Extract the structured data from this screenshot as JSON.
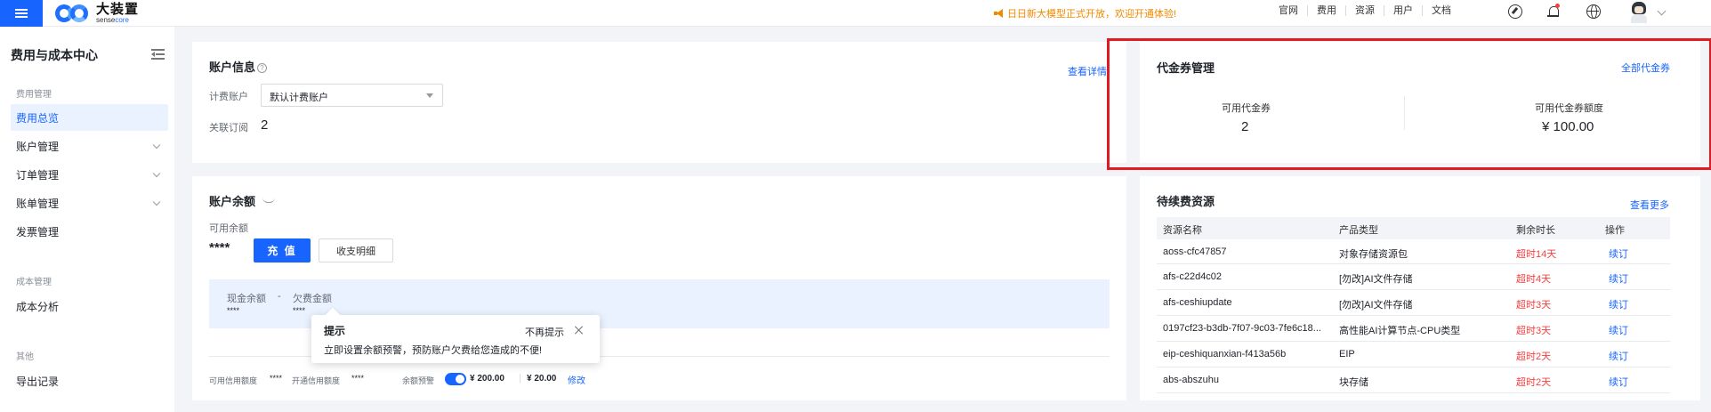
{
  "header": {
    "logo_text": "大装置",
    "logo_sub_a": "sense",
    "logo_sub_b": "core",
    "announcement": "日日新大模型正式开放，欢迎开通体验!",
    "nav": [
      "官网",
      "费用",
      "资源",
      "用户",
      "文档"
    ],
    "icons": [
      "compass-icon",
      "bell-icon",
      "globe-icon",
      "avatar"
    ]
  },
  "sidebar": {
    "title": "费用与成本中心",
    "groups": [
      {
        "label": "费用管理",
        "items": [
          {
            "label": "费用总览",
            "active": true
          },
          {
            "label": "账户管理",
            "expandable": true
          },
          {
            "label": "订单管理",
            "expandable": true
          },
          {
            "label": "账单管理",
            "expandable": true
          },
          {
            "label": "发票管理"
          }
        ]
      },
      {
        "label": "成本管理",
        "items": [
          {
            "label": "成本分析"
          }
        ]
      },
      {
        "label": "其他",
        "items": [
          {
            "label": "导出记录"
          }
        ]
      }
    ]
  },
  "account_info": {
    "title": "账户信息",
    "view_detail": "查看详情",
    "billing_label": "计费账户",
    "billing_value": "默认计费账户",
    "subscription_label": "关联订阅",
    "subscription_value": "2"
  },
  "balance": {
    "title": "账户余额",
    "available_label": "可用余额",
    "available_value": "****",
    "recharge": "充 值",
    "detail": "收支明细",
    "cash_label": "现金余额",
    "separator": "-",
    "debt_label": "欠费金额",
    "cash_value": "****",
    "debt_value": "****",
    "credit_label": "可用信用额度",
    "credit_value": "****",
    "open_credit_label": "开通信用额度",
    "open_credit_value": "****",
    "alert_label": "余额预警",
    "alert_enabled": true,
    "alert_amount": "¥ 200.00",
    "alert_amount2": "¥ 20.00",
    "modify": "修改"
  },
  "tooltip": {
    "title": "提示",
    "dismiss": "不再提示",
    "message": "立即设置余额预警，预防账户欠费给您造成的不便!"
  },
  "vouchers": {
    "title": "代金券管理",
    "all_link": "全部代金券",
    "available_label": "可用代金券",
    "available_value": "2",
    "amount_label": "可用代金券额度",
    "amount_value": "¥ 100.00"
  },
  "renewals": {
    "title": "待续费资源",
    "more": "查看更多",
    "columns": [
      "资源名称",
      "产品类型",
      "剩余时长",
      "操作"
    ],
    "rows": [
      {
        "name": "aoss-cfc47857",
        "type": "对象存储资源包",
        "remaining": "超时14天",
        "action": "续订"
      },
      {
        "name": "afs-c22d4c02",
        "type": "[勿改]AI文件存储",
        "remaining": "超时4天",
        "action": "续订"
      },
      {
        "name": "afs-ceshiupdate",
        "type": "[勿改]AI文件存储",
        "remaining": "超时3天",
        "action": "续订"
      },
      {
        "name": "0197cf23-b3db-7f07-9c03-7fe6c18...",
        "type": "高性能AI计算节点-CPU类型",
        "remaining": "超时3天",
        "action": "续订"
      },
      {
        "name": "eip-ceshiquanxian-f413a56b",
        "type": "EIP",
        "remaining": "超时2天",
        "action": "续订"
      },
      {
        "name": "abs-abszuhu",
        "type": "块存储",
        "remaining": "超时2天",
        "action": "续订"
      }
    ]
  },
  "colors": {
    "accent": "#1764ff",
    "warning": "#f08a00",
    "danger": "#f53f3f",
    "highlight_frame": "#e01b22"
  }
}
